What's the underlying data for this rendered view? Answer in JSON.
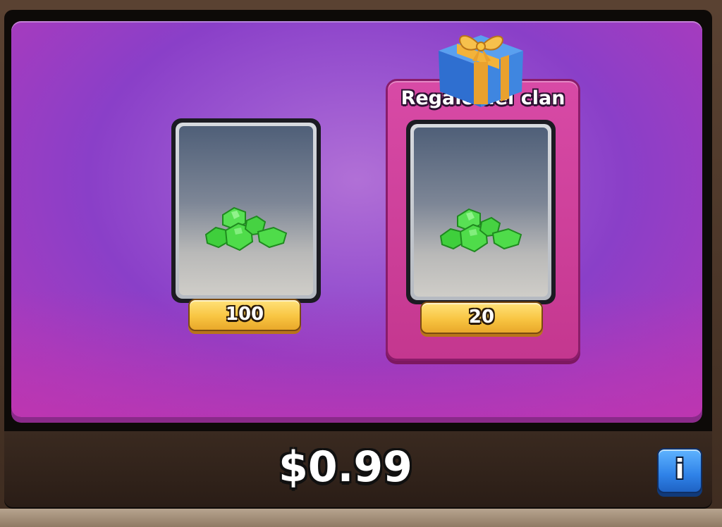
{
  "offer": {
    "items": [
      {
        "amount": "100",
        "icon": "gems-icon"
      },
      {
        "amount": "20",
        "icon": "gems-icon"
      }
    ],
    "clan_gift_label": "Regalo del clan",
    "clan_gift_icon": "gift-box-icon"
  },
  "purchase": {
    "price": "$0.99",
    "info_label": "i"
  },
  "colors": {
    "panel_purple": "#9a55d0",
    "clan_gift_pink": "#c4378f",
    "amount_pill_gold": "#f8c542",
    "gem_green": "#4fdc4a",
    "info_blue": "#2f82e8"
  }
}
